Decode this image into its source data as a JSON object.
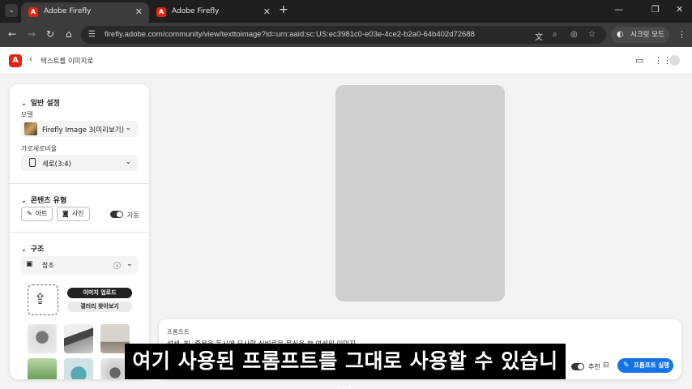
{
  "browser": {
    "tabs": [
      {
        "title": "Adobe Firefly",
        "active": true
      },
      {
        "title": "Adobe Firefly",
        "active": false
      }
    ],
    "url": "firefly.adobe.com/community/view/texttoimage?id=urn:aaid:sc:US:ec3981c0-e03e-4ce2-b2a0-64b402d72688",
    "incognito_label": "시크릿 모드"
  },
  "header": {
    "breadcrumb": "텍스트를 이미지로"
  },
  "panel": {
    "general": {
      "title": "일반 설정",
      "model_label": "모델",
      "model_value": "Firefly Image 3(미리보기)",
      "ratio_label": "가로세로비율",
      "ratio_value": "세로(3:4)"
    },
    "content_type": {
      "title": "콘텐츠 유형",
      "art_label": "아트",
      "photo_label": "사진",
      "auto_label": "자동"
    },
    "structure": {
      "title": "구조",
      "reference_label": "참조",
      "upload_label": "이미지 업로드",
      "gallery_label": "갤러리 찾아보기"
    }
  },
  "prompt": {
    "label": "프롬프트",
    "text": "섬세, 빛, 죽음을 동시에 묘사할 신비로운 문신을 한 여성의 이미지",
    "recommend_label": "추천",
    "run_label": "프롬프트 실행"
  },
  "subtitle": "여기 사용된 프롬프트를 그대로 사용할 수 있습니다",
  "colors": {
    "brand": "#e62314",
    "accent": "#1473e6"
  }
}
